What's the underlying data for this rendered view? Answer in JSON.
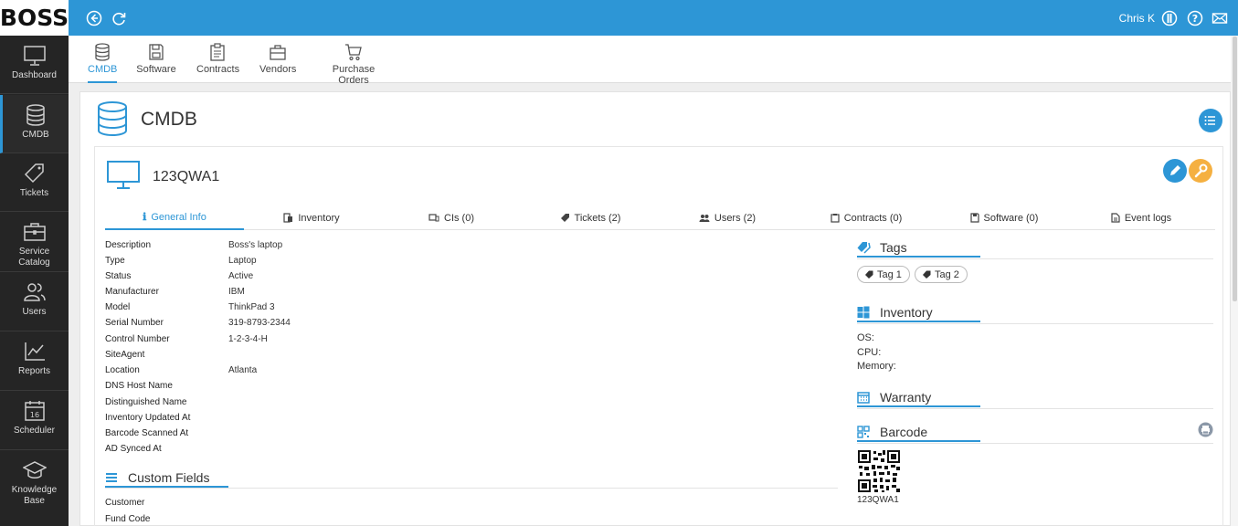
{
  "app": {
    "logo_text": "BOSS",
    "user_name": "Chris K"
  },
  "sidebar": {
    "items": [
      {
        "label": "Dashboard",
        "icon": "monitor-icon"
      },
      {
        "label": "CMDB",
        "icon": "database-icon"
      },
      {
        "label": "Tickets",
        "icon": "tag-icon"
      },
      {
        "label": "Service Catalog",
        "icon": "briefcase-icon"
      },
      {
        "label": "Users",
        "icon": "users-icon"
      },
      {
        "label": "Reports",
        "icon": "chart-icon"
      },
      {
        "label": "Scheduler",
        "icon": "calendar-icon"
      },
      {
        "label": "Knowledge Base",
        "icon": "graduation-cap-icon"
      }
    ],
    "calendar_day": "16"
  },
  "modules": [
    {
      "label": "CMDB",
      "icon": "database-icon"
    },
    {
      "label": "Software",
      "icon": "floppy-icon"
    },
    {
      "label": "Contracts",
      "icon": "clipboard-icon"
    },
    {
      "label": "Vendors",
      "icon": "briefcase-icon"
    },
    {
      "label": "Purchase Orders",
      "icon": "cart-icon"
    }
  ],
  "page": {
    "title": "CMDB"
  },
  "ci": {
    "name": "123QWA1"
  },
  "tabs": [
    {
      "label": "General Info",
      "icon": "info-icon"
    },
    {
      "label": "Inventory",
      "icon": "inventory-icon"
    },
    {
      "label": "CIs (0)",
      "icon": "devices-icon"
    },
    {
      "label": "Tickets (2)",
      "icon": "tag-icon"
    },
    {
      "label": "Users (2)",
      "icon": "users-icon"
    },
    {
      "label": "Contracts (0)",
      "icon": "clipboard-icon"
    },
    {
      "label": "Software (0)",
      "icon": "floppy-icon"
    },
    {
      "label": "Event logs",
      "icon": "document-icon"
    }
  ],
  "general": [
    {
      "label": "Description",
      "value": "Boss's laptop"
    },
    {
      "label": "Type",
      "value": "Laptop"
    },
    {
      "label": "Status",
      "value": "Active"
    },
    {
      "label": "Manufacturer",
      "value": "IBM"
    },
    {
      "label": "Model",
      "value": "ThinkPad 3"
    },
    {
      "label": "Serial Number",
      "value": "319-8793-2344"
    },
    {
      "label": "Control Number",
      "value": "1-2-3-4-H"
    },
    {
      "label": "SiteAgent",
      "value": ""
    },
    {
      "label": "Location",
      "value": "Atlanta"
    },
    {
      "label": "DNS Host Name",
      "value": ""
    },
    {
      "label": "Distinguished Name",
      "value": ""
    },
    {
      "label": "Inventory Updated At",
      "value": ""
    },
    {
      "label": "Barcode Scanned At",
      "value": ""
    },
    {
      "label": "AD Synced At",
      "value": ""
    }
  ],
  "custom_fields": {
    "title": "Custom Fields",
    "rows": [
      {
        "label": "Customer",
        "value": ""
      },
      {
        "label": "Fund Code",
        "value": ""
      }
    ]
  },
  "tags": {
    "title": "Tags",
    "items": [
      "Tag 1",
      "Tag 2"
    ]
  },
  "inventory": {
    "title": "Inventory",
    "os_label": "OS:",
    "cpu_label": "CPU:",
    "memory_label": "Memory:"
  },
  "warranty": {
    "title": "Warranty"
  },
  "barcode": {
    "title": "Barcode",
    "code": "123QWA1"
  },
  "colors": {
    "accent": "#2d96d6",
    "topbar": "#2d96d6",
    "sidebar": "#252525",
    "wrench": "#f5b041"
  }
}
